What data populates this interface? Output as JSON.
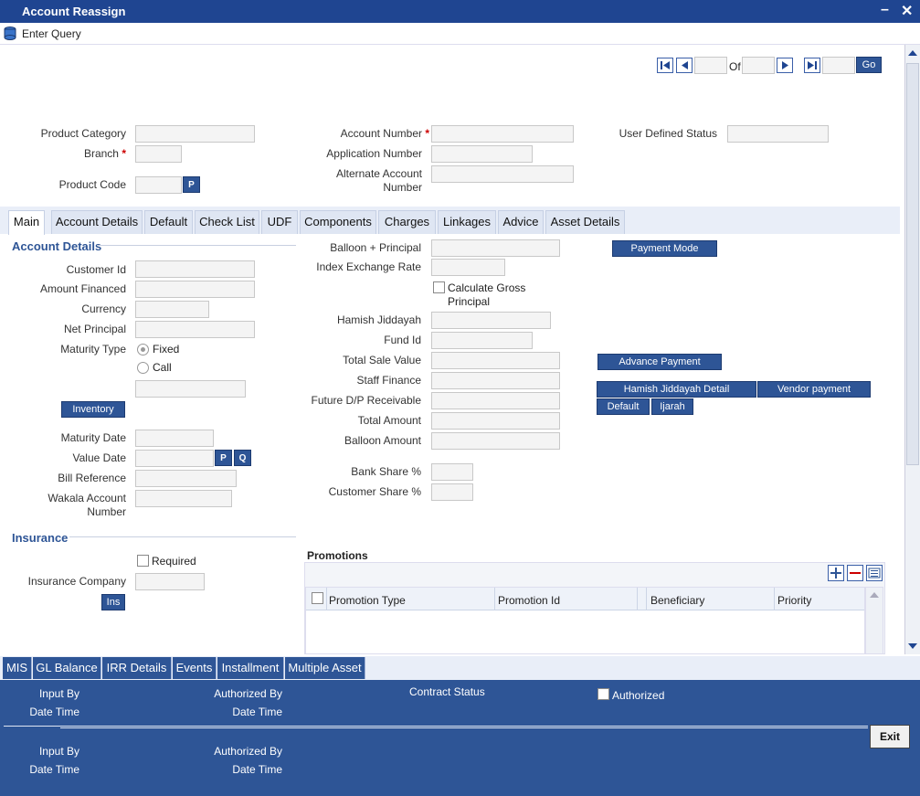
{
  "window": {
    "title": "Account Reassign"
  },
  "toolbar": {
    "enter_query": "Enter Query"
  },
  "nav": {
    "of_label": "Of",
    "go_label": "Go"
  },
  "header_fields": {
    "product_category": "Product Category",
    "branch": "Branch",
    "product_code": "Product Code",
    "p_button": "P",
    "account_number": "Account Number",
    "application_number": "Application Number",
    "alternate_account_number": "Alternate Account Number",
    "user_defined_status": "User Defined Status",
    "required_mark": "*"
  },
  "tabs": [
    "Main",
    "Account Details",
    "Default",
    "Check List",
    "UDF",
    "Components",
    "Charges",
    "Linkages",
    "Advice",
    "Asset Details"
  ],
  "account_details": {
    "section": "Account Details",
    "customer_id": "Customer Id",
    "amount_financed": "Amount Financed",
    "currency": "Currency",
    "net_principal": "Net Principal",
    "maturity_type": "Maturity Type",
    "fixed": "Fixed",
    "call": "Call",
    "inventory_button": "Inventory",
    "maturity_date": "Maturity Date",
    "value_date": "Value Date",
    "p_button": "P",
    "q_button": "Q",
    "bill_reference": "Bill Reference",
    "wakala_account_number": "Wakala Account Number"
  },
  "middle": {
    "balloon_principal": "Balloon + Principal",
    "index_exchange_rate": "Index Exchange Rate",
    "calculate_gross_principal": "Calculate Gross Principal",
    "hamish_jiddayah": "Hamish Jiddayah",
    "fund_id": "Fund Id",
    "total_sale_value": "Total Sale Value",
    "staff_finance": "Staff Finance",
    "future_dp_receivable": "Future D/P Receivable",
    "total_amount": "Total Amount",
    "balloon_amount": "Balloon Amount",
    "bank_share": "Bank Share %",
    "customer_share": "Customer Share %"
  },
  "right_buttons": {
    "payment_mode": "Payment Mode",
    "advance_payment": "Advance Payment",
    "hamish_jiddayah_detail": "Hamish Jiddayah Detail",
    "vendor_payment": "Vendor payment",
    "default": "Default",
    "ijarah": "Ijarah"
  },
  "insurance": {
    "section": "Insurance",
    "required": "Required",
    "insurance_company": "Insurance Company",
    "ins_button": "Ins"
  },
  "promotions": {
    "title": "Promotions",
    "columns": [
      "Promotion Type",
      "Promotion Id",
      "Beneficiary",
      "Priority"
    ]
  },
  "bottom_tabs": [
    "MIS",
    "GL Balance",
    "IRR Details",
    "Events",
    "Installment",
    "Multiple Asset"
  ],
  "footer": {
    "input_by": "Input By",
    "date_time": "Date Time",
    "authorized_by": "Authorized By",
    "contract_status": "Contract Status",
    "authorized": "Authorized",
    "exit": "Exit"
  },
  "colors": {
    "title_bar": "#1f4591",
    "button": "#2e5596",
    "footer": "#2e5596"
  }
}
